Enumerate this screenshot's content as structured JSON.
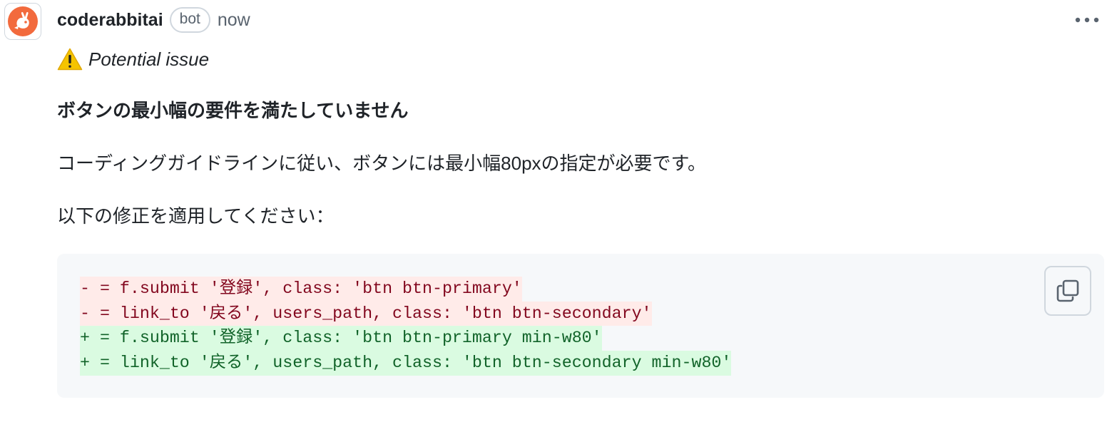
{
  "comment": {
    "author": "coderabbitai",
    "badge": "bot",
    "timestamp": "now",
    "issue_label": "Potential issue",
    "title": "ボタンの最小幅の要件を満たしていません",
    "paragraphs": [
      "コーディングガイドラインに従い、ボタンには最小幅80pxの指定が必要です。",
      "以下の修正を適用してください："
    ],
    "suggestion_lines": [
      {
        "type": "deletion",
        "text": "- = f.submit '登録', class: 'btn btn-primary'"
      },
      {
        "type": "deletion",
        "text": "- = link_to '戻る', users_path, class: 'btn btn-secondary'"
      },
      {
        "type": "addition",
        "text": "+ = f.submit '登録', class: 'btn btn-primary min-w80'"
      },
      {
        "type": "addition",
        "text": "+ = link_to '戻る', users_path, class: 'btn btn-secondary min-w80'"
      }
    ]
  },
  "icons": {
    "avatar": "coderabbit-logo-icon",
    "menu": "kebab-horizontal-icon",
    "issue": "warning-icon",
    "copy": "copy-icon"
  },
  "colors": {
    "brand": "#f26a3d",
    "deletion_bg": "#ffebe9",
    "deletion_text": "#82071e",
    "addition_bg": "#dafbe1",
    "addition_text": "#116329",
    "code_bg": "#f6f8fa",
    "warning": "#f5c400"
  }
}
